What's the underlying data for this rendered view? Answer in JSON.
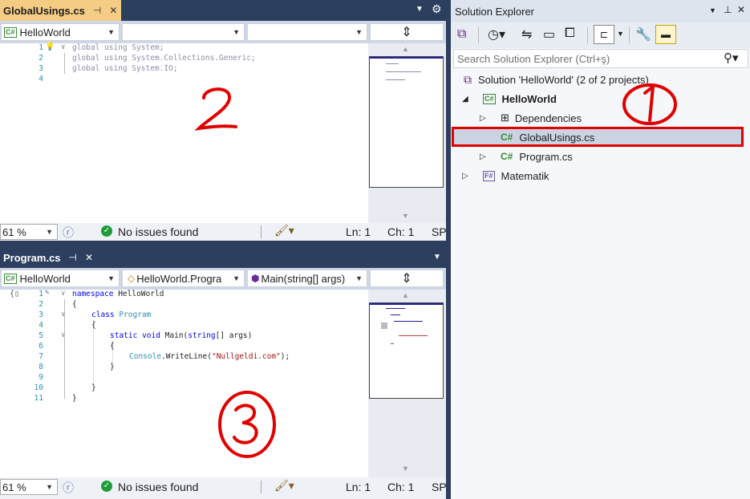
{
  "top_editor": {
    "tab_title": "GlobalUsings.cs",
    "pin_icon": "⊣",
    "close_icon": "✕",
    "nav_project": "HelloWorld",
    "lines": [
      "1",
      "2",
      "3",
      "4"
    ],
    "code": [
      [
        "global using System;"
      ],
      [
        "global using System.Collections.Generic;"
      ],
      [
        "global using System.IO;"
      ],
      [
        ""
      ]
    ],
    "zoom": "61 %",
    "issues": "No issues found",
    "ln": "Ln: 1",
    "ch": "Ch: 1",
    "sp": "SP",
    "annotation": "2"
  },
  "bottom_editor": {
    "tab_title": "Program.cs",
    "pin_icon": "⊣",
    "close_icon": "✕",
    "nav_project": "HelloWorld",
    "nav_class": "HelloWorld.Progra",
    "nav_member": "Main(string[] args)",
    "lines": [
      "1",
      "2",
      "3",
      "4",
      "5",
      "6",
      "7",
      "8",
      "9",
      "10",
      "11"
    ],
    "code_text": {
      "l1_kw": "namespace",
      "l1_name": " HelloWorld",
      "l2": "{",
      "l3_kw": "class",
      "l3_type": "Program",
      "l4": "{",
      "l5_kw1": "static",
      "l5_kw2": "void",
      "l5_rest1": " Main(",
      "l5_kw3": "string",
      "l5_rest2": "[] args)",
      "l6": "{",
      "l7_type": "Console",
      "l7_mid": ".WriteLine(",
      "l7_str": "\"Nullgeldi.com\"",
      "l7_end": ");",
      "l8": "}",
      "l10": "}",
      "l11": "}"
    },
    "zoom": "61 %",
    "issues": "No issues found",
    "ln": "Ln: 1",
    "ch": "Ch: 1",
    "sp": "SP",
    "annotation": "3"
  },
  "solution_explorer": {
    "title": "Solution Explorer",
    "search_placeholder": "Search Solution Explorer (Ctrl+ş)",
    "solution": "Solution 'HelloWorld' (2 of 2 projects)",
    "project": "HelloWorld",
    "dependencies": "Dependencies",
    "global_usings": "GlobalUsings.cs",
    "program": "Program.cs",
    "matematik": "Matematik",
    "annotation": "1"
  },
  "colors": {
    "accent_tab": "#f5cc84",
    "frame": "#2d3f5f",
    "annotation": "#e00000"
  }
}
